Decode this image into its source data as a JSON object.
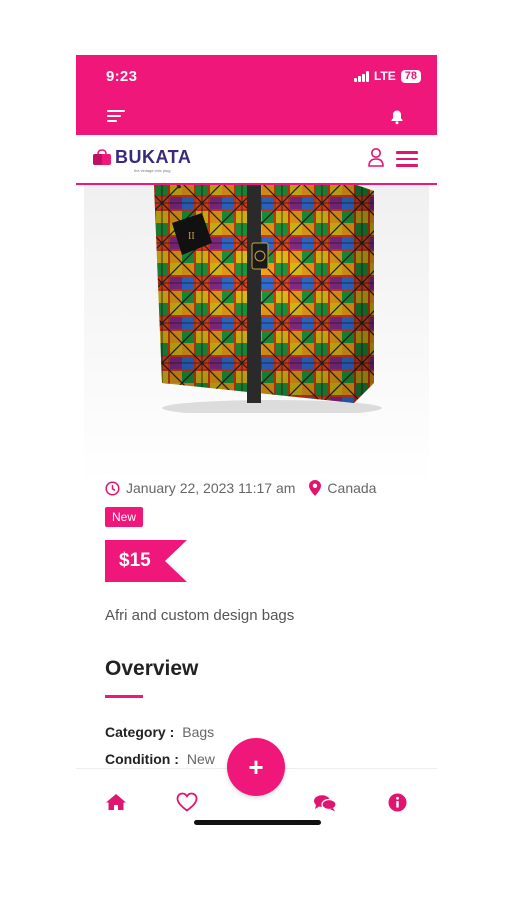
{
  "status_bar": {
    "time": "9:23",
    "network": "LTE",
    "battery": "78"
  },
  "header": {
    "logo_text": "BUKATA",
    "logo_tagline": "the vintage chic plug"
  },
  "listing": {
    "date": "January 22, 2023 11:17 am",
    "location": "Canada",
    "badge": "New",
    "price": "$15",
    "description": "Afri and custom design bags",
    "overview_title": "Overview",
    "details": [
      {
        "label": "Category :",
        "value": "Bags"
      },
      {
        "label": "Condition :",
        "value": "New"
      }
    ]
  },
  "fab": {
    "label": "+"
  },
  "colors": {
    "accent": "#f0177a",
    "logo": "#3a2a7a"
  },
  "icons": [
    "menu-icon",
    "bell-icon",
    "user-icon",
    "hamburger-icon",
    "clock-icon",
    "location-pin-icon",
    "home-icon",
    "heart-icon",
    "chat-icon",
    "info-icon"
  ]
}
